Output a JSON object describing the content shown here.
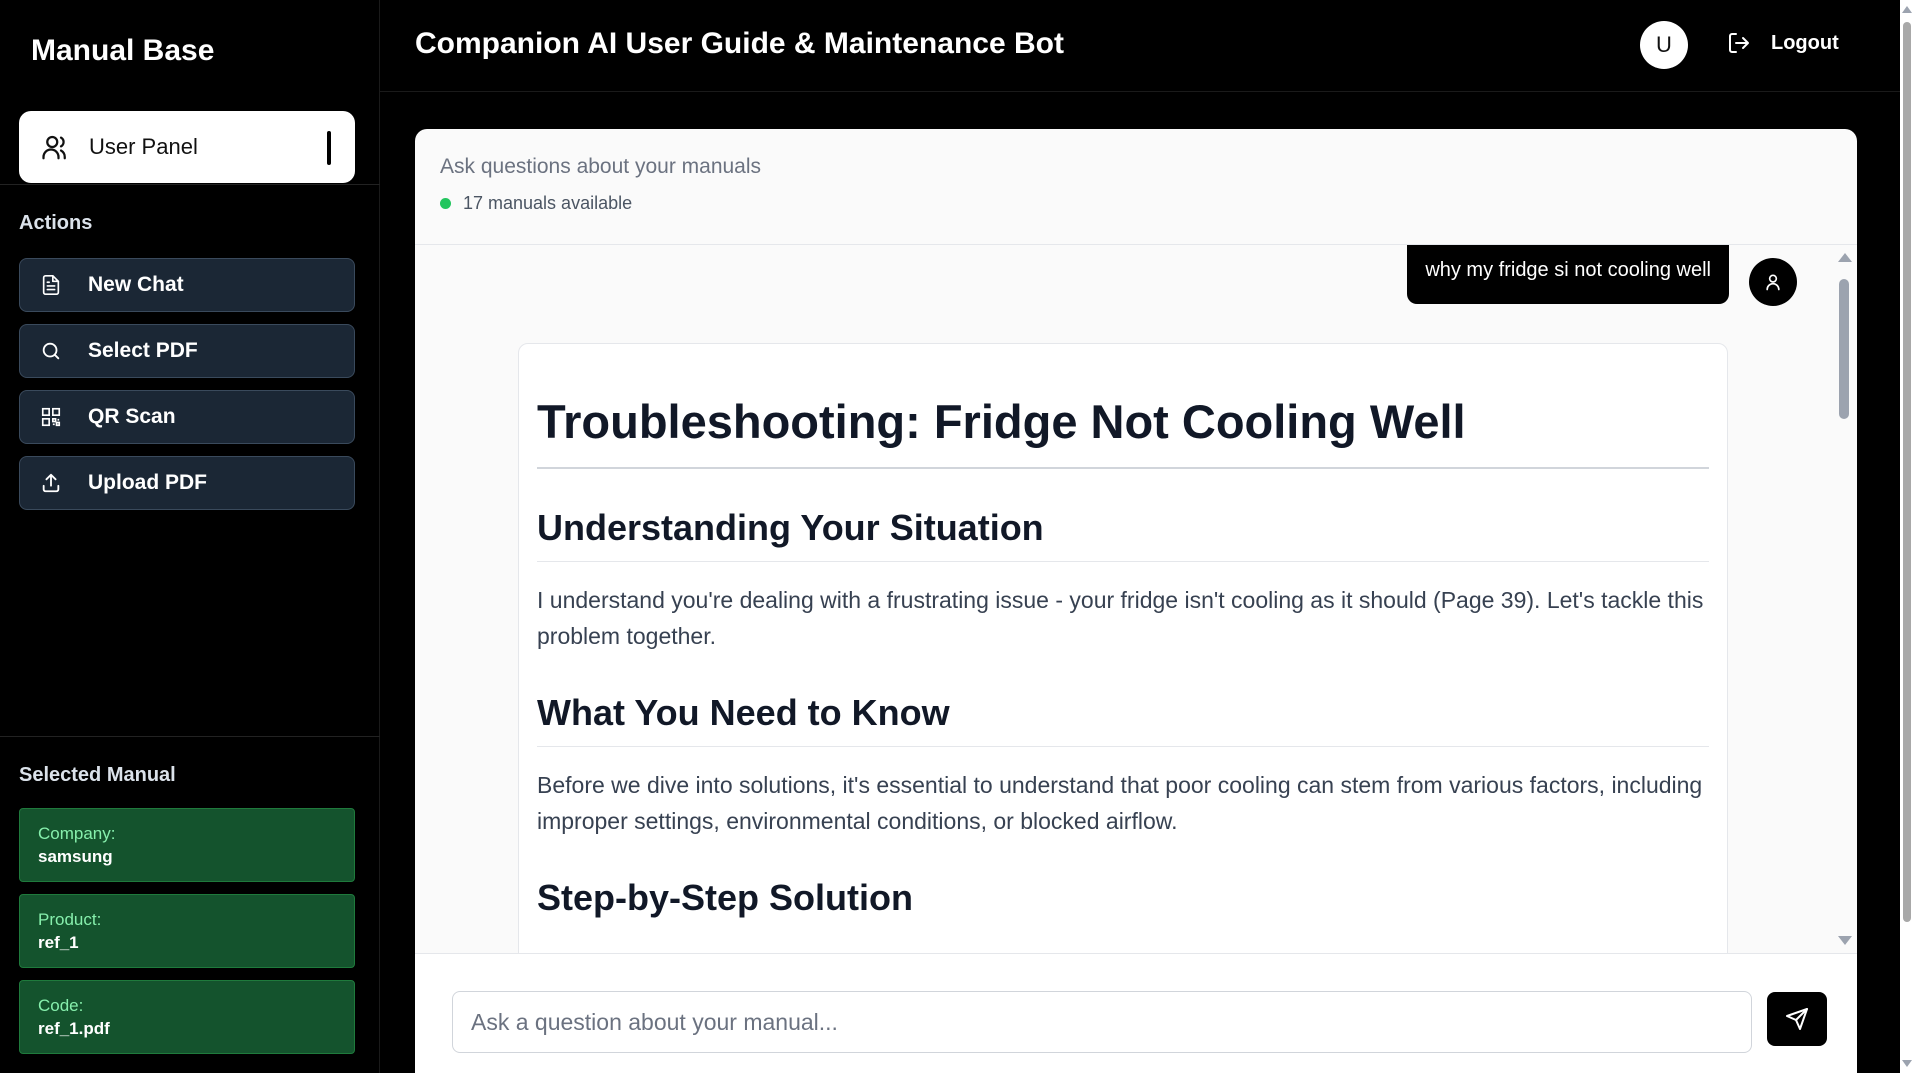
{
  "sidebar": {
    "brand": "Manual Base",
    "user_panel_label": "User Panel",
    "actions_heading": "Actions",
    "actions": [
      {
        "label": "New Chat",
        "icon": "document-icon"
      },
      {
        "label": "Select PDF",
        "icon": "search-icon"
      },
      {
        "label": "QR Scan",
        "icon": "qr-code-icon"
      },
      {
        "label": "Upload PDF",
        "icon": "upload-icon"
      }
    ],
    "selected_heading": "Selected Manual",
    "selected": [
      {
        "key": "Company:",
        "value": "samsung"
      },
      {
        "key": "Product:",
        "value": "ref_1"
      },
      {
        "key": "Code:",
        "value": "ref_1.pdf"
      }
    ]
  },
  "header": {
    "title": "Companion AI User Guide & Maintenance Bot",
    "avatar_initial": "U",
    "logout_label": "Logout"
  },
  "chat": {
    "subtitle": "Ask questions about your manuals",
    "status": "17 manuals available",
    "status_color": "#22c55e",
    "user_message": "why my fridge si not cooling well",
    "answer": {
      "title": "Troubleshooting: Fridge Not Cooling Well",
      "h_situation": "Understanding Your Situation",
      "p_situation": "I understand you're dealing with a frustrating issue - your fridge isn't cooling as it should (Page 39). Let's tackle this problem together.",
      "h_know": "What You Need to Know",
      "p_know": "Before we dive into solutions, it's essential to understand that poor cooling can stem from various factors, including improper settings, environmental conditions, or blocked airflow.",
      "h_steps": "Step-by-Step Solution"
    },
    "input_placeholder": "Ask a question about your manual..."
  },
  "colors": {
    "sidebar_button_bg": "#1b2735",
    "selected_card_bg": "#14532d",
    "accent_green_text": "#86efac"
  }
}
